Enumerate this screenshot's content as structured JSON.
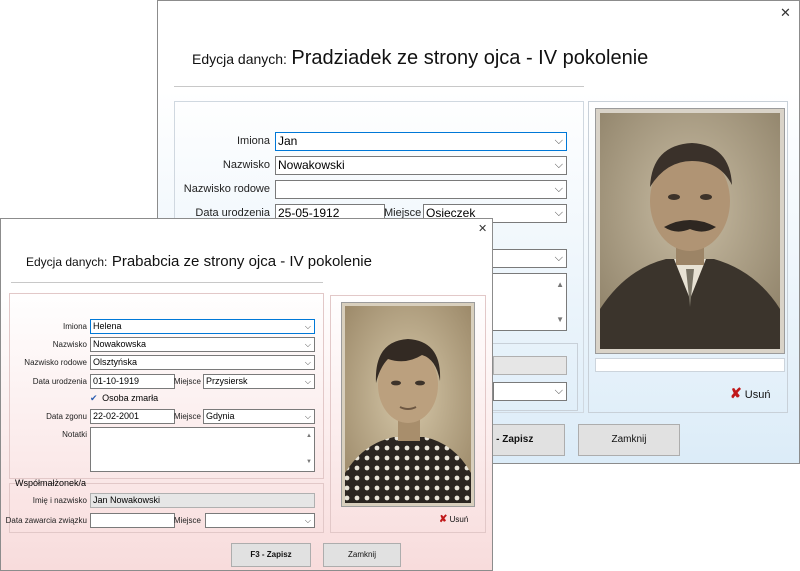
{
  "back_window": {
    "title_prefix": "Edycja danych:",
    "title": "Pradziadek ze strony ojca - IV pokolenie",
    "close_glyph": "✕",
    "fields": {
      "imiona": {
        "label": "Imiona",
        "value": "Jan"
      },
      "nazwisko": {
        "label": "Nazwisko",
        "value": "Nowakowski"
      },
      "nazwisko_rodowe": {
        "label": "Nazwisko rodowe",
        "value": ""
      },
      "data_urodzenia": {
        "label": "Data urodzenia",
        "value": "25-05-1912"
      },
      "miejsce": {
        "label": "Miejsce",
        "value": "Osieczek"
      }
    },
    "delete_label": "Usuń",
    "save_label": "F3 - Zapisz",
    "close_label": "Zamknij"
  },
  "front_window": {
    "title_prefix": "Edycja danych:",
    "title": "Prababcia ze strony ojca - IV pokolenie",
    "close_glyph": "✕",
    "fields": {
      "imiona": {
        "label": "Imiona",
        "value": "Helena"
      },
      "nazwisko": {
        "label": "Nazwisko",
        "value": "Nowakowska"
      },
      "nazwisko_rodowe": {
        "label": "Nazwisko rodowe",
        "value": "Olsztyńska"
      },
      "data_urodzenia": {
        "label": "Data urodzenia",
        "value": "01-10-1919"
      },
      "miejsce_urodzenia": {
        "label": "Miejsce",
        "value": "Przysiersk"
      },
      "osoba_zmarla": {
        "label": "Osoba zmarła",
        "checked": true
      },
      "data_zgonu": {
        "label": "Data zgonu",
        "value": "22-02-2001"
      },
      "miejsce_zgonu": {
        "label": "Miejsce",
        "value": "Gdynia"
      },
      "notatki": {
        "label": "Notatki",
        "value": ""
      }
    },
    "spouse_section": {
      "legend": "Współmałżonek/a",
      "imie_nazwisko": {
        "label": "Imię i nazwisko",
        "value": "Jan Nowakowski"
      },
      "data_zawarcia": {
        "label": "Data zawarcia związku",
        "value": ""
      },
      "miejsce": {
        "label": "Miejsce",
        "value": ""
      }
    },
    "delete_label": "Usuń",
    "save_label": "F3 - Zapisz",
    "close_label": "Zamknij"
  },
  "icons": {
    "dropdown": "chevron-down-icon",
    "delete": "red-x-icon",
    "check": "checkmark-icon",
    "close": "close-icon"
  },
  "colors": {
    "back_bg": "#dcecf8",
    "front_bg": "#f8dcdc",
    "delete_icon": "#c0181a",
    "field_focus_border": "#0078d7"
  }
}
